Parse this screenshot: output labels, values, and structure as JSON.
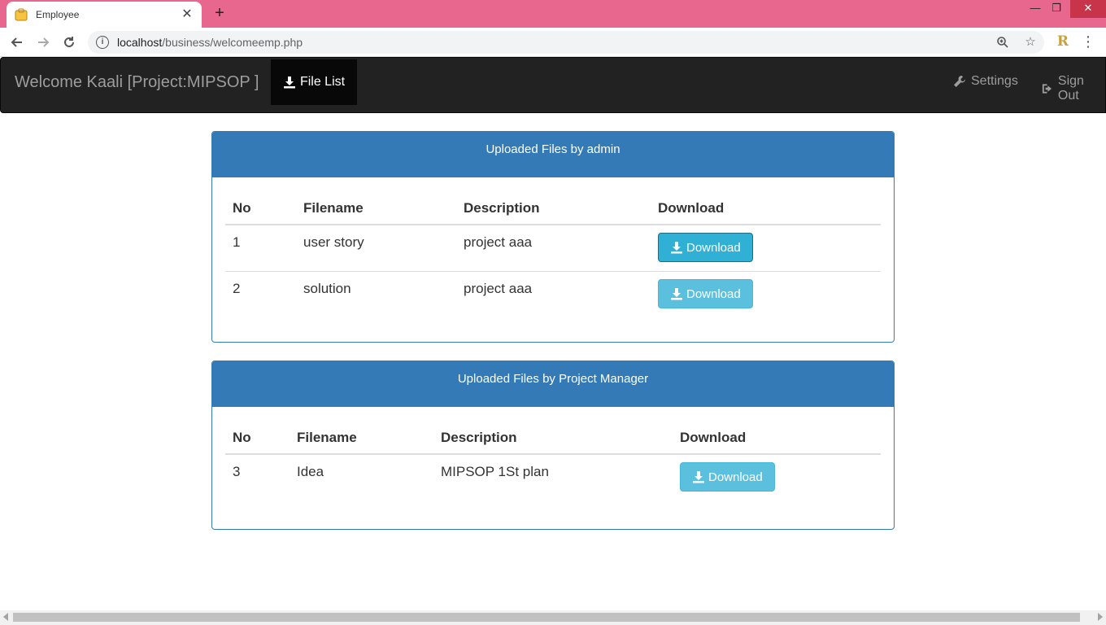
{
  "browser": {
    "tab_title": "Employee",
    "tab_close": "✕",
    "new_tab": "+",
    "url_host": "localhost",
    "url_path": "/business/welcomeemp.php",
    "extension_letter": "R",
    "window_controls": {
      "minimize": "—",
      "maximize": "❐",
      "close": "✕"
    }
  },
  "navbar": {
    "brand": "Welcome Kaali [Project:MIPSOP ]",
    "active_item": "File List",
    "settings": "Settings",
    "sign_out": "Sign Out"
  },
  "panels": [
    {
      "heading": "Uploaded Files by admin",
      "columns": [
        "No",
        "Filename",
        "Description",
        "Download"
      ],
      "rows": [
        {
          "no": "1",
          "filename": "user story",
          "description": "project aaa",
          "button": "Download"
        },
        {
          "no": "2",
          "filename": "solution",
          "description": "project aaa",
          "button": "Download"
        }
      ]
    },
    {
      "heading": "Uploaded Files by Project Manager",
      "columns": [
        "No",
        "Filename",
        "Description",
        "Download"
      ],
      "rows": [
        {
          "no": "3",
          "filename": "Idea",
          "description": "MIPSOP 1St plan",
          "button": "Download"
        }
      ]
    }
  ],
  "colors": {
    "tab_strip": "#e8678f",
    "navbar": "#222222",
    "panel_primary": "#337ab7",
    "button_info": "#5bc0de"
  }
}
